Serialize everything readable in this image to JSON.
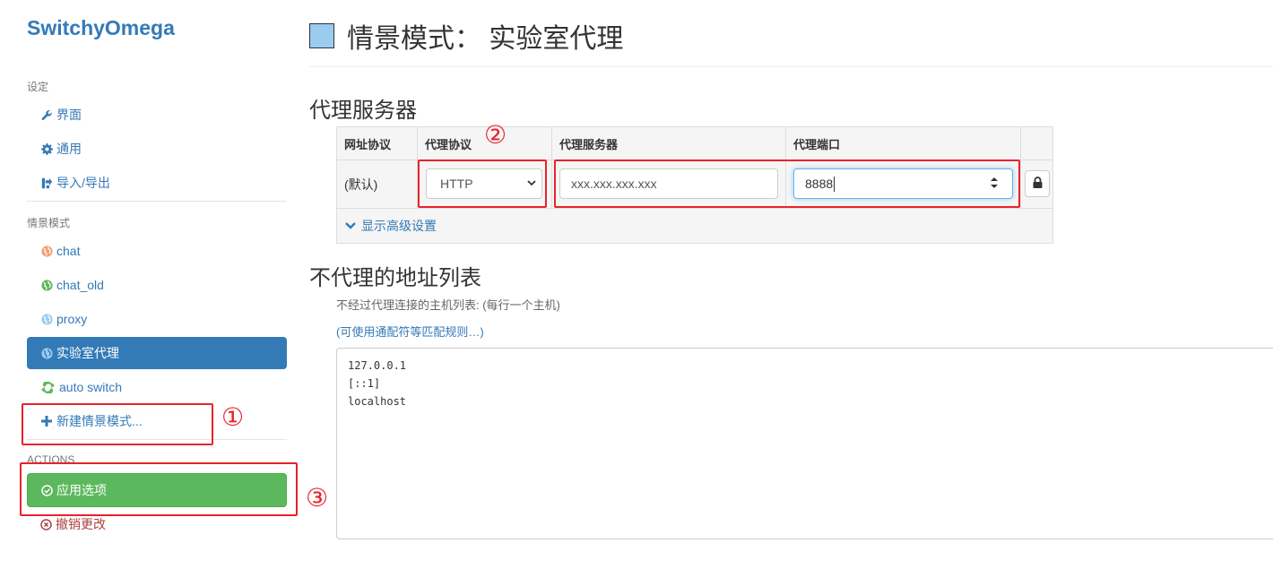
{
  "brand": "SwitchyOmega",
  "sidebar": {
    "settings_header": "设定",
    "settings_items": [
      {
        "label": "界面",
        "icon": "wrench-icon"
      },
      {
        "label": "通用",
        "icon": "gear-icon"
      },
      {
        "label": "导入/导出",
        "icon": "import-export-icon"
      }
    ],
    "profiles_header": "情景模式",
    "profiles": [
      {
        "label": "chat",
        "icon": "globe-icon",
        "color": "#f0a070"
      },
      {
        "label": "chat_old",
        "icon": "globe-icon",
        "color": "#5cb85c"
      },
      {
        "label": "proxy",
        "icon": "globe-icon",
        "color": "#99ccee"
      },
      {
        "label": "实验室代理",
        "icon": "globe-icon",
        "color": "#99ccee",
        "active": true
      },
      {
        "label": "auto switch",
        "icon": "auto-switch-icon",
        "color": "#5cb85c"
      }
    ],
    "new_profile": "新建情景模式...",
    "actions_header": "ACTIONS",
    "apply": "应用选项",
    "revert": "撤销更改"
  },
  "main": {
    "title": "情景模式： 实验室代理",
    "profile_color": "#99ccee",
    "proxy_section_title": "代理服务器",
    "table_headers": [
      "网址协议",
      "代理协议",
      "代理服务器",
      "代理端口"
    ],
    "row": {
      "scheme": "(默认)",
      "protocol": "HTTP",
      "server": "xxx.xxx.xxx.xxx",
      "port": "8888"
    },
    "advanced_label": "显示高级设置",
    "bypass_section_title": "不代理的地址列表",
    "bypass_help": "不经过代理连接的主机列表: (每行一个主机)",
    "wildcard_link": "(可使用通配符等匹配规则…)",
    "bypass_list": [
      "127.0.0.1",
      "[::1]",
      "localhost"
    ]
  },
  "annotations": {
    "marker_1": "①",
    "marker_2": "②",
    "marker_3": "③",
    "color": "#e8232b"
  }
}
